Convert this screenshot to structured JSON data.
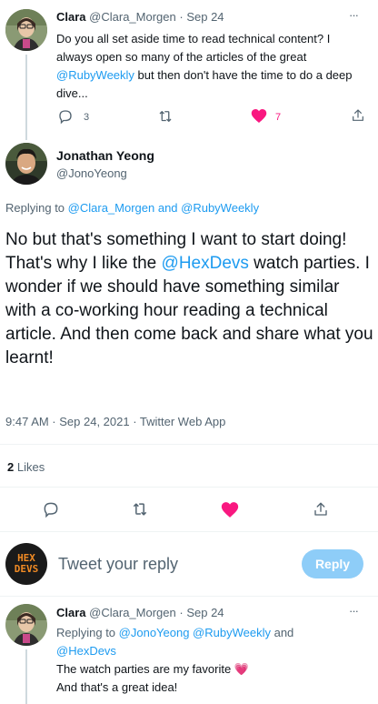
{
  "parent_tweet": {
    "name": "Clara",
    "handle": "@Clara_Morgen",
    "dot": "·",
    "date": "Sep 24",
    "more": "···",
    "text_1": "Do you all set aside time to read technical content? I always open so many of the articles of the great ",
    "mention": "@RubyWeekly",
    "text_2": " but then don't have the time to do a deep dive...",
    "reply_count": "3",
    "like_count": "7"
  },
  "main_tweet": {
    "name": "Jonathan Yeong",
    "handle": "@JonoYeong",
    "replying_prefix": "Replying to ",
    "replying_users": "@Clara_Morgen and @RubyWeekly",
    "text_1": "No but that's something I want to start doing! That's why I like the ",
    "mention": "@HexDevs",
    "text_2": " watch parties. I wonder if we should have something similar with a co-working hour reading a technical article. And then come back and share what you learnt!",
    "timestamp": "9:47 AM · Sep 24, 2021 · Twitter Web App",
    "likes_count": "2",
    "likes_label": "Likes"
  },
  "reply_box": {
    "avatar_text_1": "HEX",
    "avatar_text_2": "DEVS",
    "placeholder": "Tweet your reply",
    "button": "Reply"
  },
  "reply_tweet": {
    "name": "Clara",
    "handle": "@Clara_Morgen",
    "dot": "·",
    "date": "Sep 24",
    "more": "···",
    "replying_prefix": "Replying to ",
    "replying_users_1": "@JonoYeong @RubyWeekly",
    "replying_and": " and",
    "replying_users_2": "@HexDevs",
    "line_1": "The watch parties are my favorite ",
    "heart_emoji": "💗",
    "line_2": "And that's a great idea!"
  },
  "colors": {
    "accent": "#1d9bf0",
    "like": "#f91880",
    "text": "#0f1419",
    "secondary": "#536471",
    "hex_orange": "#f08a24"
  },
  "icons": [
    "reply-icon",
    "retweet-icon",
    "like-icon",
    "share-icon",
    "more-icon"
  ]
}
